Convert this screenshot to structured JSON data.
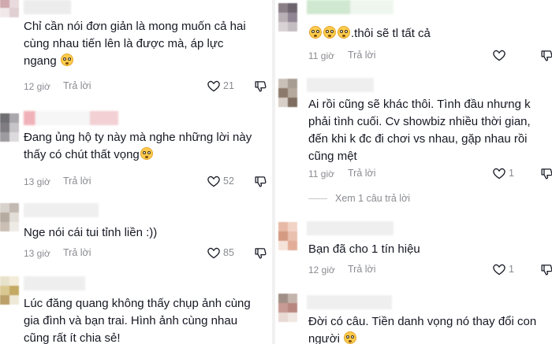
{
  "left": {
    "comments": [
      {
        "text_lines": [
          "Chỉ cần nói đơn giản là mong muốn cả hai",
          "cùng nhau tiến lên là được mà, áp lực",
          "ngang"
        ],
        "time": "12 giờ",
        "reply": "Trả lời",
        "likes": "21"
      },
      {
        "text_lines": [
          "Đang ủng hộ ty này mà nghe những lời này",
          "thấy có chút thất vọng"
        ],
        "time": "13 giờ",
        "reply": "Trả lời",
        "likes": "52"
      },
      {
        "text_lines": [
          "Nge nói cái tui tỉnh liền :))"
        ],
        "time": "13 giờ",
        "reply": "Trả lời",
        "likes": "85"
      },
      {
        "text_lines": [
          "Lúc đăng quang không thấy chụp ảnh cùng",
          "gia đình và bạn trai. Hình ảnh cùng nhau",
          "cũng rất ít chia sẻ!"
        ]
      }
    ]
  },
  "right": {
    "comments": [
      {
        "text_lines": [
          ".thôi sẽ tl tất cả"
        ],
        "time": "11 giờ",
        "reply": "Trả lời"
      },
      {
        "text_lines": [
          "Ai rồi cũng sẽ khác thôi. Tình đầu nhưng k",
          "phải tình cuối. Cv showbiz nhiều thời gian,",
          "đến khi k đc đi chơi vs nhau, gặp nhau rồi",
          "cũng mệt"
        ],
        "time": "11 giờ",
        "reply": "Trả lời",
        "likes": "1",
        "view_more": "Xem 1 câu trả lời"
      },
      {
        "text_lines": [
          "Bạn đã cho 1 tín hiệu"
        ],
        "time": "12 giờ",
        "reply": "Trả lời",
        "likes": "1"
      },
      {
        "text_lines": [
          "Đời có câu. Tiền danh vọng nó thay đổi con",
          "người"
        ]
      }
    ]
  },
  "colors": {
    "text": "#161823",
    "meta": "#8a8b91",
    "background": "#ffffff",
    "emoji": "#ffcc4d"
  },
  "icons": [
    "heart-outline-icon",
    "thumbs-down-outline-icon",
    "emoji-flushed-icon",
    "emoji-pleading-icon",
    "emoji-smiling-hearts-icon"
  ]
}
